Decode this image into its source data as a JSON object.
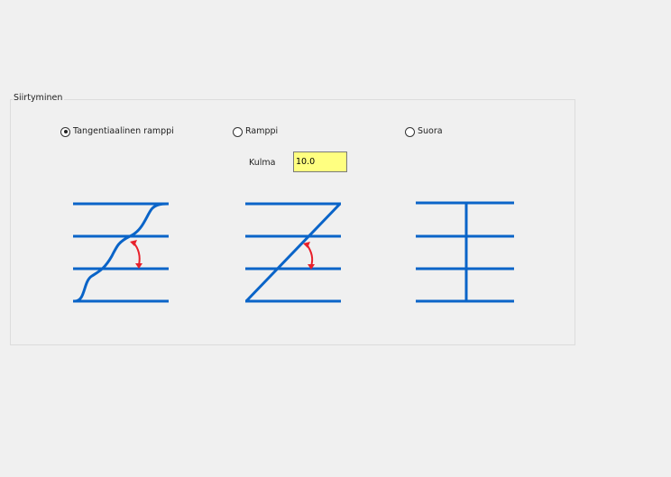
{
  "group": {
    "title": "Siirtyminen"
  },
  "options": [
    {
      "label": "Tangentiaalinen ramppi",
      "selected": true
    },
    {
      "label": "Ramppi",
      "selected": false
    },
    {
      "label": "Suora",
      "selected": false
    }
  ],
  "angle": {
    "label": "Kulma",
    "value": "10.0"
  },
  "colors": {
    "background": "#f0f0f0",
    "line_blue": "#0a64c8",
    "arrow_red": "#e8202a",
    "input_bg": "#ffff80"
  },
  "icons": {
    "tangential": "tangential-ramp-diagram-icon",
    "ramp": "ramp-diagram-icon",
    "straight": "straight-diagram-icon"
  }
}
